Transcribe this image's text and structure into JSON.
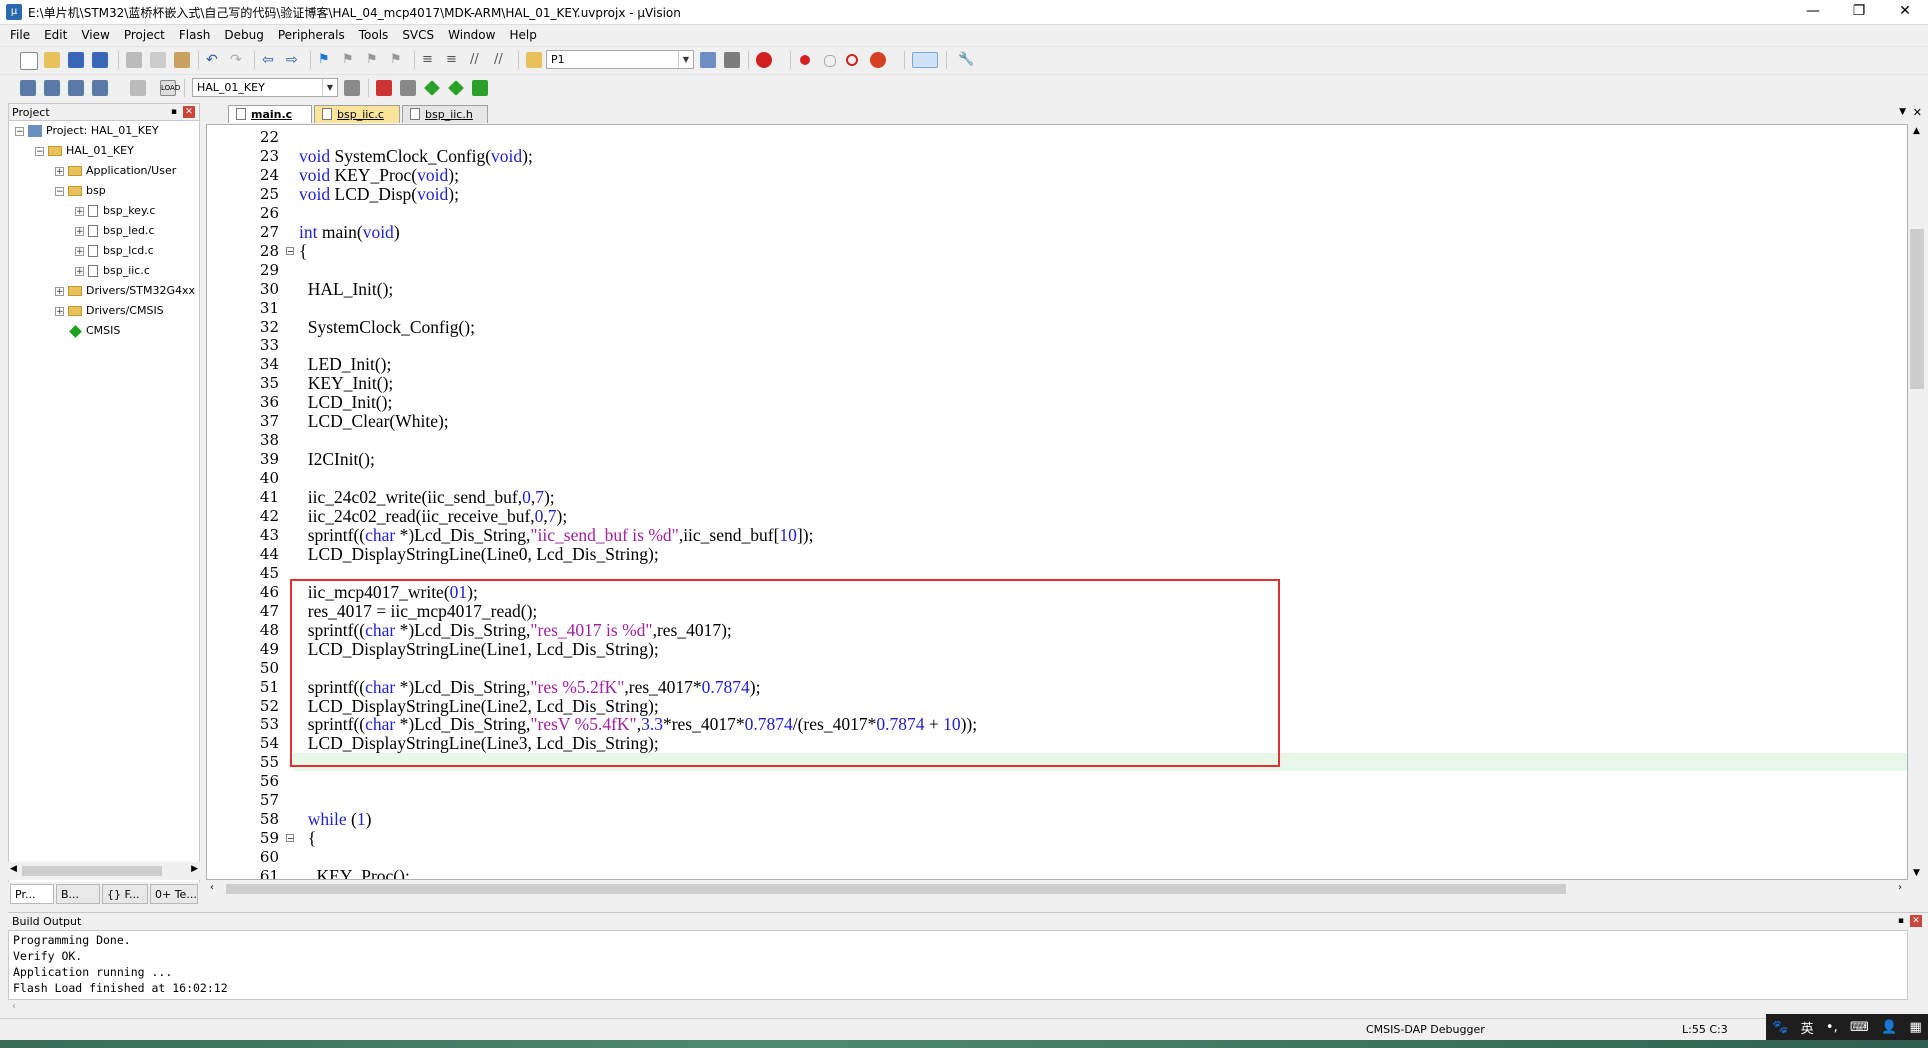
{
  "window": {
    "title": "E:\\单片机\\STM32\\蓝桥杯嵌入式\\自己写的代码\\验证博客\\HAL_04_mcp4017\\MDK-ARM\\HAL_01_KEY.uvprojx - µVision",
    "minimize": "—",
    "maximize": "❐",
    "close": "✕"
  },
  "menu": [
    "File",
    "Edit",
    "View",
    "Project",
    "Flash",
    "Debug",
    "Peripherals",
    "Tools",
    "SVCS",
    "Window",
    "Help"
  ],
  "toolbar1": {
    "find_combo": "P1"
  },
  "toolbar2": {
    "target_combo": "HAL_01_KEY"
  },
  "project": {
    "header": "Project",
    "pin": "📌",
    "close": "✕",
    "tree": [
      {
        "label": "Project: HAL_01_KEY",
        "level": 0,
        "type": "project",
        "toggle": "−"
      },
      {
        "label": "HAL_01_KEY",
        "level": 1,
        "type": "folder",
        "toggle": "−"
      },
      {
        "label": "Application/User",
        "level": 2,
        "type": "folder",
        "toggle": "+"
      },
      {
        "label": "bsp",
        "level": 2,
        "type": "folder",
        "toggle": "−"
      },
      {
        "label": "bsp_key.c",
        "level": 3,
        "type": "file",
        "toggle": "+"
      },
      {
        "label": "bsp_led.c",
        "level": 3,
        "type": "file",
        "toggle": "+"
      },
      {
        "label": "bsp_lcd.c",
        "level": 3,
        "type": "file",
        "toggle": "+"
      },
      {
        "label": "bsp_iic.c",
        "level": 3,
        "type": "file",
        "toggle": "+"
      },
      {
        "label": "Drivers/STM32G4xx",
        "level": 2,
        "type": "folder",
        "toggle": "+"
      },
      {
        "label": "Drivers/CMSIS",
        "level": 2,
        "type": "folder",
        "toggle": "+"
      },
      {
        "label": "CMSIS",
        "level": 2,
        "type": "component",
        "toggle": ""
      }
    ],
    "bottom_tabs": [
      "Pr...",
      "B...",
      "{} F...",
      "0+ Te..."
    ]
  },
  "editor": {
    "tabs": [
      {
        "label": "main.c",
        "active": true
      },
      {
        "label": "bsp_iic.c",
        "active": false
      },
      {
        "label": "bsp_iic.h",
        "active": false
      }
    ],
    "current_line": 55,
    "lines": [
      {
        "n": "22",
        "t": ""
      },
      {
        "n": "23",
        "t": "void SystemClock_Config(void);"
      },
      {
        "n": "24",
        "t": "void KEY_Proc(void);"
      },
      {
        "n": "25",
        "t": "void LCD_Disp(void);"
      },
      {
        "n": "26",
        "t": ""
      },
      {
        "n": "27",
        "t": "int main(void)"
      },
      {
        "n": "28",
        "t": "{",
        "fold": "−"
      },
      {
        "n": "29",
        "t": ""
      },
      {
        "n": "30",
        "t": "  HAL_Init();"
      },
      {
        "n": "31",
        "t": ""
      },
      {
        "n": "32",
        "t": "  SystemClock_Config();"
      },
      {
        "n": "33",
        "t": ""
      },
      {
        "n": "34",
        "t": "  LED_Init();"
      },
      {
        "n": "35",
        "t": "  KEY_Init();"
      },
      {
        "n": "36",
        "t": "  LCD_Init();"
      },
      {
        "n": "37",
        "t": "  LCD_Clear(White);"
      },
      {
        "n": "38",
        "t": ""
      },
      {
        "n": "39",
        "t": "  I2CInit();"
      },
      {
        "n": "40",
        "t": ""
      },
      {
        "n": "41",
        "t": "  iic_24c02_write(iic_send_buf,0,7);"
      },
      {
        "n": "42",
        "t": "  iic_24c02_read(iic_receive_buf,0,7);"
      },
      {
        "n": "43",
        "t": "  sprintf((char *)Lcd_Dis_String,\"iic_send_buf is %d\",iic_send_buf[10]);"
      },
      {
        "n": "44",
        "t": "  LCD_DisplayStringLine(Line0, Lcd_Dis_String);"
      },
      {
        "n": "45",
        "t": ""
      },
      {
        "n": "46",
        "t": "  iic_mcp4017_write(01);"
      },
      {
        "n": "47",
        "t": "  res_4017 = iic_mcp4017_read();"
      },
      {
        "n": "48",
        "t": "  sprintf((char *)Lcd_Dis_String,\"res_4017 is %d\",res_4017);"
      },
      {
        "n": "49",
        "t": "  LCD_DisplayStringLine(Line1, Lcd_Dis_String);"
      },
      {
        "n": "50",
        "t": ""
      },
      {
        "n": "51",
        "t": "  sprintf((char *)Lcd_Dis_String,\"res %5.2fK\",res_4017*0.7874);"
      },
      {
        "n": "52",
        "t": "  LCD_DisplayStringLine(Line2, Lcd_Dis_String);"
      },
      {
        "n": "53",
        "t": "  sprintf((char *)Lcd_Dis_String,\"resV %5.4fK\",3.3*res_4017*0.7874/(res_4017*0.7874 + 10));"
      },
      {
        "n": "54",
        "t": "  LCD_DisplayStringLine(Line3, Lcd_Dis_String);"
      },
      {
        "n": "55",
        "t": ""
      },
      {
        "n": "56",
        "t": ""
      },
      {
        "n": "57",
        "t": ""
      },
      {
        "n": "58",
        "t": "  while (1)"
      },
      {
        "n": "59",
        "t": "  {",
        "fold": "−"
      },
      {
        "n": "60",
        "t": ""
      },
      {
        "n": "61",
        "t": "    KEY_Proc();"
      }
    ]
  },
  "build_output": {
    "header": "Build Output",
    "lines": [
      "Programming Done.",
      "Verify OK.",
      "Application running ...",
      "Flash Load finished at 16:02:12"
    ]
  },
  "status": {
    "debugger": "CMSIS-DAP Debugger",
    "position": "L:55 C:3"
  },
  "ime": {
    "lang": "英"
  }
}
